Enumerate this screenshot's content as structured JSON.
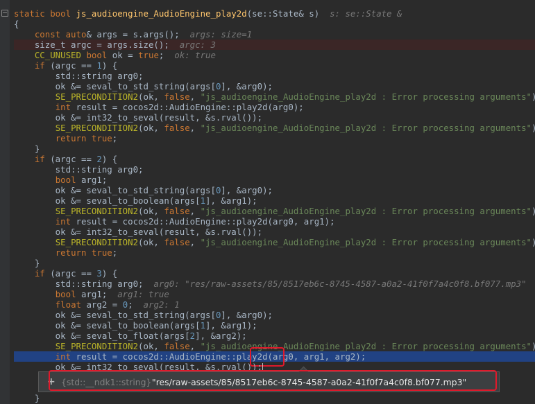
{
  "editor": {
    "tooltip": {
      "type_label": "{std::__ndk1::string}",
      "value": "\"res/raw-assets/85/8517eb6c-8745-4587-a0a2-41f0f7a4c0f8.bf077.mp3\""
    }
  }
}
